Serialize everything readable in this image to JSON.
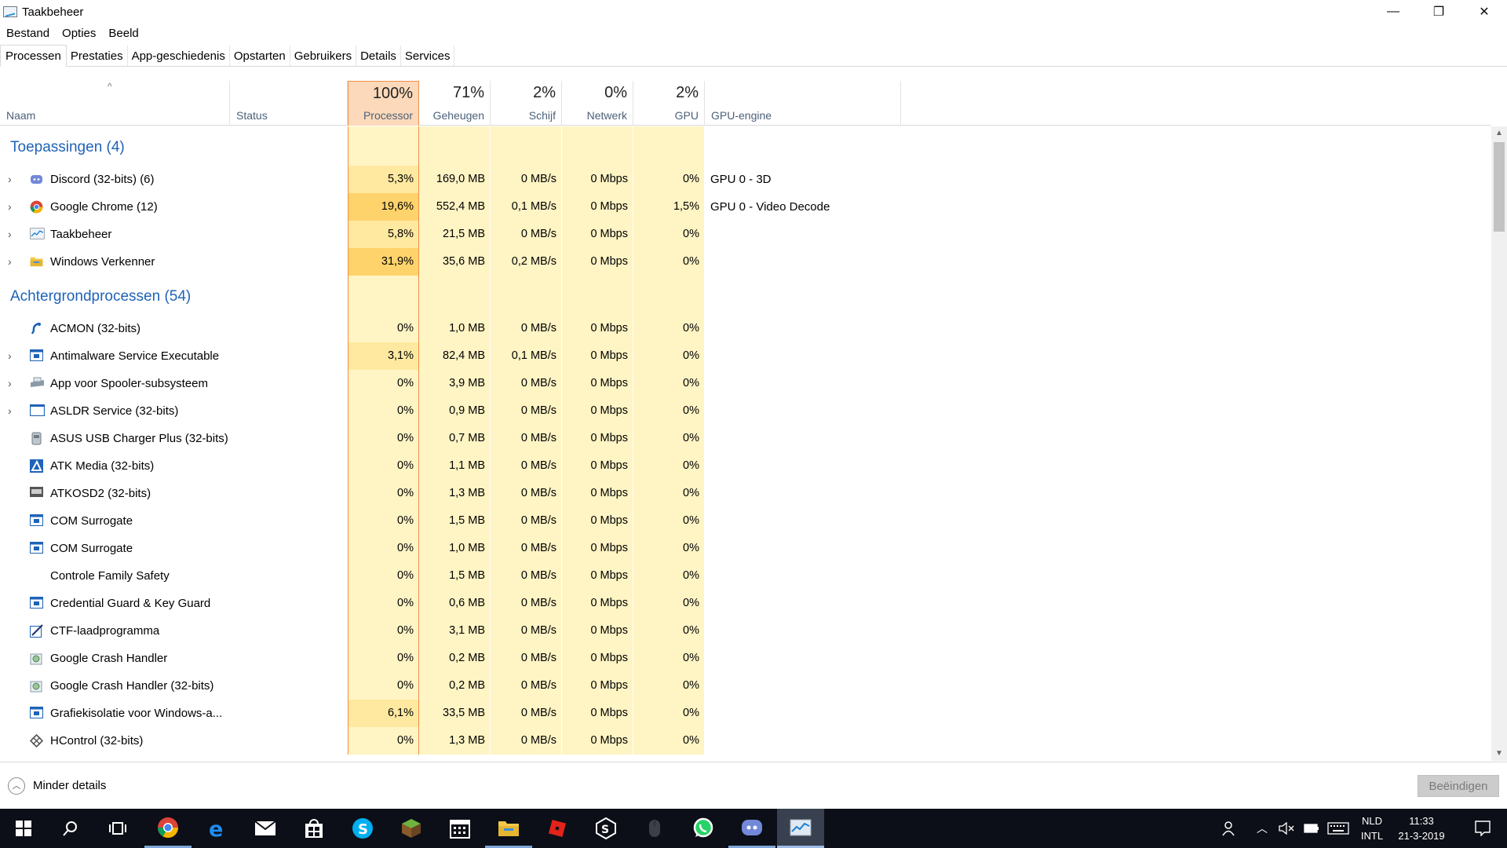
{
  "window": {
    "title": "Taakbeheer",
    "controls": {
      "minimize": "—",
      "restore": "❐",
      "close": "✕"
    }
  },
  "menu": [
    "Bestand",
    "Opties",
    "Beeld"
  ],
  "tabs": [
    "Processen",
    "Prestaties",
    "App-geschiedenis",
    "Opstarten",
    "Gebruikers",
    "Details",
    "Services"
  ],
  "active_tab": "Processen",
  "columns": {
    "name": "Naam",
    "status": "Status",
    "cpu": {
      "pct": "100%",
      "label": "Processor"
    },
    "memory": {
      "pct": "71%",
      "label": "Geheugen"
    },
    "disk": {
      "pct": "2%",
      "label": "Schijf"
    },
    "network": {
      "pct": "0%",
      "label": "Netwerk"
    },
    "gpu": {
      "pct": "2%",
      "label": "GPU"
    },
    "gpu_engine": "GPU-engine",
    "sort_arrow": "^"
  },
  "groups": [
    {
      "title": "Toepassingen (4)",
      "rows": [
        {
          "expand": true,
          "icon": "discord-icon",
          "name": "Discord (32-bits) (6)",
          "cpu": "5,3%",
          "mem": "169,0 MB",
          "disk": "0 MB/s",
          "net": "0 Mbps",
          "gpu": "0%",
          "engine": "GPU 0 - 3D",
          "cpuLevel": 1
        },
        {
          "expand": true,
          "icon": "chrome-icon",
          "name": "Google Chrome (12)",
          "cpu": "19,6%",
          "mem": "552,4 MB",
          "disk": "0,1 MB/s",
          "net": "0 Mbps",
          "gpu": "1,5%",
          "engine": "GPU 0 - Video Decode",
          "cpuLevel": 2
        },
        {
          "expand": true,
          "icon": "taskmanager-icon",
          "name": "Taakbeheer",
          "cpu": "5,8%",
          "mem": "21,5 MB",
          "disk": "0 MB/s",
          "net": "0 Mbps",
          "gpu": "0%",
          "engine": "",
          "cpuLevel": 1
        },
        {
          "expand": true,
          "icon": "folder-icon",
          "name": "Windows Verkenner",
          "cpu": "31,9%",
          "mem": "35,6 MB",
          "disk": "0,2 MB/s",
          "net": "0 Mbps",
          "gpu": "0%",
          "engine": "",
          "cpuLevel": 2
        }
      ]
    },
    {
      "title": "Achtergrondprocessen (54)",
      "rows": [
        {
          "expand": false,
          "icon": "acmon-icon",
          "name": "ACMON (32-bits)",
          "cpu": "0%",
          "mem": "1,0 MB",
          "disk": "0 MB/s",
          "net": "0 Mbps",
          "gpu": "0%",
          "engine": "",
          "cpuLevel": 0
        },
        {
          "expand": true,
          "icon": "service-icon",
          "name": "Antimalware Service Executable",
          "cpu": "3,1%",
          "mem": "82,4 MB",
          "disk": "0,1 MB/s",
          "net": "0 Mbps",
          "gpu": "0%",
          "engine": "",
          "cpuLevel": 1
        },
        {
          "expand": true,
          "icon": "printer-icon",
          "name": "App voor Spooler-subsysteem",
          "cpu": "0%",
          "mem": "3,9 MB",
          "disk": "0 MB/s",
          "net": "0 Mbps",
          "gpu": "0%",
          "engine": "",
          "cpuLevel": 0
        },
        {
          "expand": true,
          "icon": "window-icon",
          "name": "ASLDR Service (32-bits)",
          "cpu": "0%",
          "mem": "0,9 MB",
          "disk": "0 MB/s",
          "net": "0 Mbps",
          "gpu": "0%",
          "engine": "",
          "cpuLevel": 0
        },
        {
          "expand": false,
          "icon": "usb-charger-icon",
          "name": "ASUS USB Charger Plus (32-bits)",
          "cpu": "0%",
          "mem": "0,7 MB",
          "disk": "0 MB/s",
          "net": "0 Mbps",
          "gpu": "0%",
          "engine": "",
          "cpuLevel": 0
        },
        {
          "expand": false,
          "icon": "atk-media-icon",
          "name": "ATK Media (32-bits)",
          "cpu": "0%",
          "mem": "1,1 MB",
          "disk": "0 MB/s",
          "net": "0 Mbps",
          "gpu": "0%",
          "engine": "",
          "cpuLevel": 0
        },
        {
          "expand": false,
          "icon": "osd-icon",
          "name": "ATKOSD2 (32-bits)",
          "cpu": "0%",
          "mem": "1,3 MB",
          "disk": "0 MB/s",
          "net": "0 Mbps",
          "gpu": "0%",
          "engine": "",
          "cpuLevel": 0
        },
        {
          "expand": false,
          "icon": "service-icon",
          "name": "COM Surrogate",
          "cpu": "0%",
          "mem": "1,5 MB",
          "disk": "0 MB/s",
          "net": "0 Mbps",
          "gpu": "0%",
          "engine": "",
          "cpuLevel": 0
        },
        {
          "expand": false,
          "icon": "service-icon",
          "name": "COM Surrogate",
          "cpu": "0%",
          "mem": "1,0 MB",
          "disk": "0 MB/s",
          "net": "0 Mbps",
          "gpu": "0%",
          "engine": "",
          "cpuLevel": 0
        },
        {
          "expand": false,
          "icon": "",
          "name": "Controle Family Safety",
          "cpu": "0%",
          "mem": "1,5 MB",
          "disk": "0 MB/s",
          "net": "0 Mbps",
          "gpu": "0%",
          "engine": "",
          "cpuLevel": 0
        },
        {
          "expand": false,
          "icon": "service-icon",
          "name": "Credential Guard & Key Guard",
          "cpu": "0%",
          "mem": "0,6 MB",
          "disk": "0 MB/s",
          "net": "0 Mbps",
          "gpu": "0%",
          "engine": "",
          "cpuLevel": 0
        },
        {
          "expand": false,
          "icon": "ctf-icon",
          "name": "CTF-laadprogramma",
          "cpu": "0%",
          "mem": "3,1 MB",
          "disk": "0 MB/s",
          "net": "0 Mbps",
          "gpu": "0%",
          "engine": "",
          "cpuLevel": 0
        },
        {
          "expand": false,
          "icon": "crash-handler-icon",
          "name": "Google Crash Handler",
          "cpu": "0%",
          "mem": "0,2 MB",
          "disk": "0 MB/s",
          "net": "0 Mbps",
          "gpu": "0%",
          "engine": "",
          "cpuLevel": 0
        },
        {
          "expand": false,
          "icon": "crash-handler-icon",
          "name": "Google Crash Handler (32-bits)",
          "cpu": "0%",
          "mem": "0,2 MB",
          "disk": "0 MB/s",
          "net": "0 Mbps",
          "gpu": "0%",
          "engine": "",
          "cpuLevel": 0
        },
        {
          "expand": false,
          "icon": "service-icon",
          "name": "Grafiekisolatie voor Windows-a...",
          "cpu": "6,1%",
          "mem": "33,5 MB",
          "disk": "0 MB/s",
          "net": "0 Mbps",
          "gpu": "0%",
          "engine": "",
          "cpuLevel": 1
        },
        {
          "expand": false,
          "icon": "hcontrol-icon",
          "name": "HControl (32-bits)",
          "cpu": "0%",
          "mem": "1,3 MB",
          "disk": "0 MB/s",
          "net": "0 Mbps",
          "gpu": "0%",
          "engine": "",
          "cpuLevel": 0
        }
      ]
    }
  ],
  "footer": {
    "less_details": "Minder details",
    "end_task": "Beëindigen"
  },
  "taskbar": {
    "apps": [
      "start-icon",
      "search-icon",
      "task-view-icon",
      "chrome-icon",
      "edge-icon",
      "mail-icon",
      "store-icon",
      "skype-icon",
      "minecraft-icon",
      "calendar-icon",
      "file-explorer-icon",
      "roblox-icon",
      "cryptic-app-icon",
      "mouse-icon",
      "whatsapp-icon",
      "discord-icon",
      "taskmanager-icon"
    ],
    "lang": [
      "NLD",
      "INTL"
    ],
    "time": "11:33",
    "date": "21-3-2019"
  },
  "colors": {
    "accent_blue": "#1e63b8",
    "cpu_header": "#fcd9ba",
    "heat_low": "#fff4c4",
    "heat_mid": "#ffe9a0",
    "heat_high": "#ffd36b",
    "taskbar": "#0c0f17"
  }
}
